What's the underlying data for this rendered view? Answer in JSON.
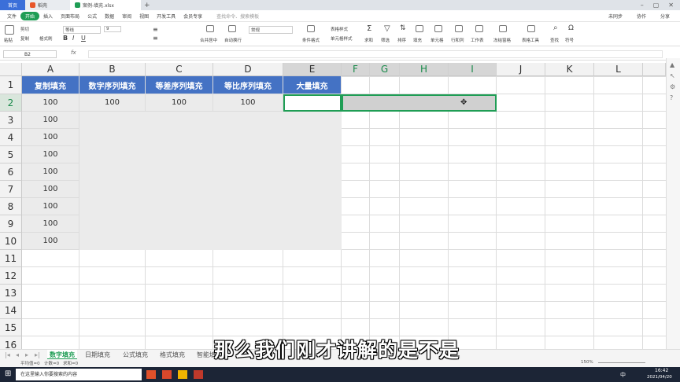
{
  "titlebar": {
    "home_tab": "首页",
    "tab1": "稻壳",
    "tab2": "案例-填充.xlsx"
  },
  "menu": {
    "file": "文件",
    "start": "开始",
    "items": [
      "插入",
      "页面布局",
      "公式",
      "数据",
      "审阅",
      "视图",
      "开发工具",
      "会员专享"
    ],
    "search": "查找命令、搜索模板",
    "collab": "未同步",
    "share": "协作",
    "share2": "分享"
  },
  "ribbon": {
    "paste": "粘贴",
    "cut": "剪切",
    "copy": "复制",
    "format_painter": "格式刷",
    "font_name": "等线",
    "font_size": "9",
    "merge": "合并居中",
    "wrap": "自动换行",
    "number_format": "常规",
    "cond_format": "条件格式",
    "table_style": "表格样式",
    "cell_style": "单元格样式",
    "sum": "求和",
    "filter": "筛选",
    "sort": "排序",
    "fill": "填充",
    "cell": "单元格",
    "rowcol": "行和列",
    "worksheet": "工作表",
    "freeze": "冻结窗格",
    "table_tools": "表格工具",
    "find": "查找",
    "symbol": "符号"
  },
  "namebox": {
    "ref": "B2",
    "fx": "fx"
  },
  "columns": [
    "A",
    "B",
    "C",
    "D",
    "E",
    "F",
    "G",
    "H",
    "I",
    "J",
    "K",
    "L"
  ],
  "rows": [
    "1",
    "2",
    "3",
    "4",
    "5",
    "6",
    "7",
    "8",
    "9",
    "10",
    "11",
    "12",
    "13",
    "14",
    "15",
    "16"
  ],
  "headers": [
    "复制填充",
    "数字序列填充",
    "等差序列填充",
    "等比序列填充",
    "大量填充"
  ],
  "row2_values": [
    "100",
    "100",
    "100",
    "100"
  ],
  "colA_values": [
    "100",
    "100",
    "100",
    "100",
    "100",
    "100",
    "100",
    "100",
    "100"
  ],
  "sheets": [
    "数字填充",
    "日期填充",
    "公式填充",
    "格式填充",
    "智能填"
  ],
  "status": {
    "avg": "平均值=0",
    "count": "计数=0",
    "sum": "求和=0",
    "zoom": "150%"
  },
  "taskbar": {
    "search": "在这里输入你要搜索的内容",
    "time": "16:42",
    "date": "2021/04/20",
    "ime": "中"
  },
  "subtitle": "那么我们刚才讲解的是不是"
}
